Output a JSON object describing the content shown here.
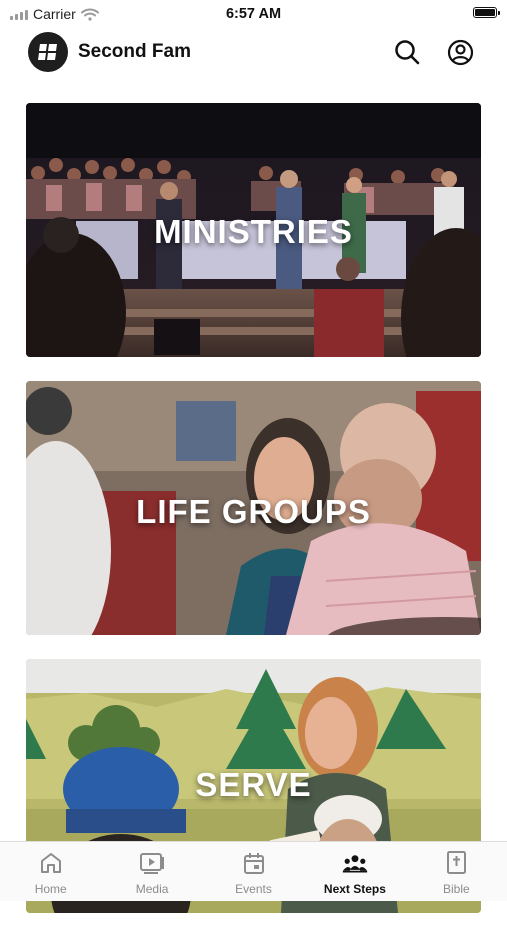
{
  "status_bar": {
    "carrier": "Carrier",
    "time": "6:57 AM"
  },
  "header": {
    "title": "Second Fam"
  },
  "cards": [
    {
      "label": "MINISTRIES"
    },
    {
      "label": "LIFE GROUPS"
    },
    {
      "label": "SERVE"
    }
  ],
  "tabs": [
    {
      "label": "Home",
      "icon": "home-icon",
      "active": false
    },
    {
      "label": "Media",
      "icon": "media-icon",
      "active": false
    },
    {
      "label": "Events",
      "icon": "calendar-icon",
      "active": false
    },
    {
      "label": "Next Steps",
      "icon": "people-icon",
      "active": true
    },
    {
      "label": "Bible",
      "icon": "bible-icon",
      "active": false
    }
  ]
}
